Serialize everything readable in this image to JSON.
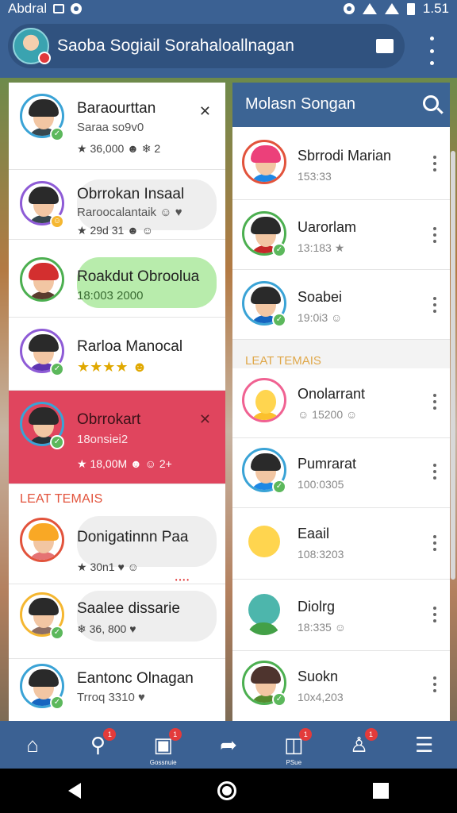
{
  "status_bar": {
    "carrier": "Abdral",
    "time": "1.51"
  },
  "app_bar": {
    "title": "Saoba Sogiail Sorahaloallnagan"
  },
  "left_panel": {
    "section_label": "LEAT TEMAIS",
    "rows": [
      {
        "name": "Baraourttan",
        "sub": "Saraa so9v0",
        "meta": "★ 36,000 ☻ ❄ 2"
      },
      {
        "name": "Obrrokan Insaal",
        "sub": "Raroocalantaik ☺ ♥",
        "meta": "★ 29d 31 ☻ ☺"
      },
      {
        "name": "Roakdut Obroolua",
        "sub": "18:003 2000",
        "meta": ""
      },
      {
        "name": "Rarloa Manocal",
        "sub": "",
        "meta": "★★★★ ☻"
      },
      {
        "name": "Obrrokart",
        "sub": "18onsiei2",
        "meta": "★ 18,00M ☻ ☺ 2+"
      },
      {
        "name": "Donigatinnn Paa",
        "sub": "",
        "meta": "★ 30n1 ♥ ☺"
      },
      {
        "name": "Saalee dissarie",
        "sub": "",
        "meta": "❄ 36, 800 ♥"
      },
      {
        "name": "Eantonc Olnagan",
        "sub": "Trroq 3310 ♥",
        "meta": ""
      }
    ]
  },
  "right_panel": {
    "title": "Molasn Songan",
    "section_label": "LEAT TEMAIS",
    "rows": [
      {
        "name": "Sbrrodi Marian",
        "sub": "153:33"
      },
      {
        "name": "Uarorlam",
        "sub": "13:183 ★"
      },
      {
        "name": "Soabei",
        "sub": "19:0i3 ☺"
      },
      {
        "name": "Onolarrant",
        "sub": "☺ 15200 ☺"
      },
      {
        "name": "Pumrarat",
        "sub": "100:0305"
      },
      {
        "name": "Eaail",
        "sub": "108:3203"
      },
      {
        "name": "Diolrg",
        "sub": "18:335 ☺"
      },
      {
        "name": "Suokn",
        "sub": "10x4,203"
      }
    ]
  },
  "bottom_nav": {
    "items": [
      {
        "icon": "home-icon",
        "glyph": "⌂",
        "badge": "",
        "label": ""
      },
      {
        "icon": "search-icon",
        "glyph": "⚲",
        "badge": "1",
        "label": ""
      },
      {
        "icon": "gallery-icon",
        "glyph": "▣",
        "badge": "1",
        "label": "Gossnuie"
      },
      {
        "icon": "share-icon",
        "glyph": "➦",
        "badge": "",
        "label": ""
      },
      {
        "icon": "bookmark-icon",
        "glyph": "◫",
        "badge": "1",
        "label": "PSue"
      },
      {
        "icon": "profile-icon",
        "glyph": "♙",
        "badge": "1",
        "label": ""
      },
      {
        "icon": "menu-icon",
        "glyph": "☰",
        "badge": "",
        "label": ""
      }
    ]
  },
  "colors": {
    "primary": "#3b6193",
    "active_row": "#e0455e",
    "accent": "#e2533c"
  }
}
